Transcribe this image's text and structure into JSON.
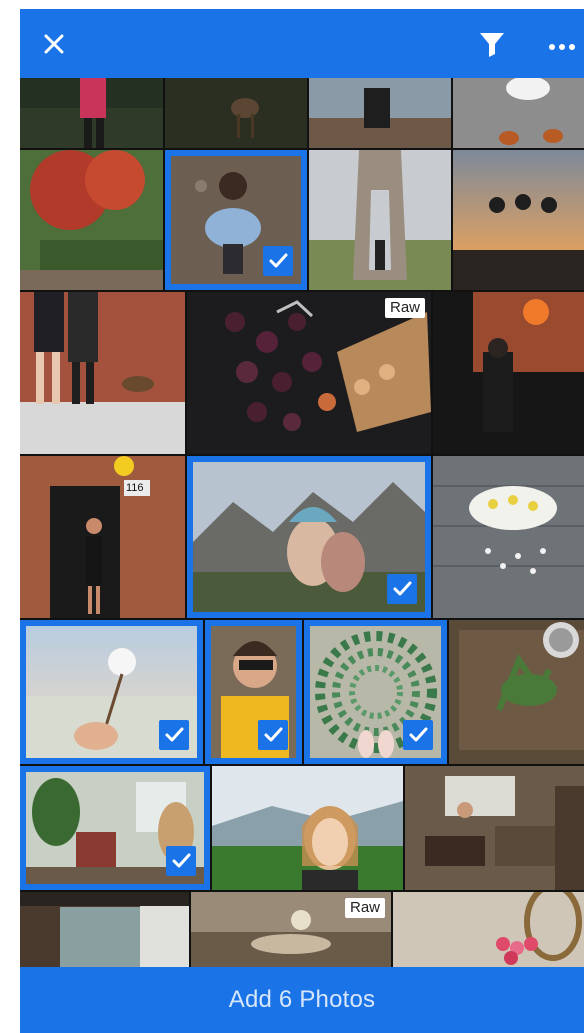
{
  "toolbar": {
    "close_icon": "close-icon",
    "filter_icon": "filter-icon",
    "more_icon": "more-icon"
  },
  "badges": {
    "raw": "Raw"
  },
  "door_number": "116",
  "photos": [
    {
      "subject": "woman-in-pink-forest",
      "selected": false
    },
    {
      "subject": "deer-in-forest",
      "selected": false
    },
    {
      "subject": "person-on-coast",
      "selected": false
    },
    {
      "subject": "feet-on-pavement",
      "selected": false
    },
    {
      "subject": "red-autumn-tree",
      "selected": false
    },
    {
      "subject": "man-looking-up",
      "selected": true
    },
    {
      "subject": "bridge-tower",
      "selected": false
    },
    {
      "subject": "three-people-jumping-sunset",
      "selected": false
    },
    {
      "subject": "couple-with-dog-brick-wall",
      "selected": false
    },
    {
      "subject": "plums-on-cutting-board",
      "selected": false,
      "raw": true
    },
    {
      "subject": "woman-with-orange-balloon",
      "selected": false
    },
    {
      "subject": "woman-at-door-116",
      "selected": false
    },
    {
      "subject": "woman-reaching-mountains",
      "selected": true
    },
    {
      "subject": "flower-cloud-art",
      "selected": false
    },
    {
      "subject": "cotton-flower-field",
      "selected": true
    },
    {
      "subject": "man-with-sunglasses",
      "selected": true
    },
    {
      "subject": "leaf-mandala-feet",
      "selected": true
    },
    {
      "subject": "plant-on-wooden-table",
      "selected": false
    },
    {
      "subject": "living-room-plants",
      "selected": true
    },
    {
      "subject": "woman-smiling-hills",
      "selected": false
    },
    {
      "subject": "cafe-interior",
      "selected": false
    },
    {
      "subject": "room-interior",
      "selected": false
    },
    {
      "subject": "table-decor",
      "selected": false,
      "raw": true
    },
    {
      "subject": "pink-flowers-mirror",
      "selected": false
    }
  ],
  "bottom_bar": {
    "label": "Add 6 Photos"
  },
  "colors": {
    "accent": "#1b73e8",
    "bottom_text": "#d6e6fb"
  }
}
